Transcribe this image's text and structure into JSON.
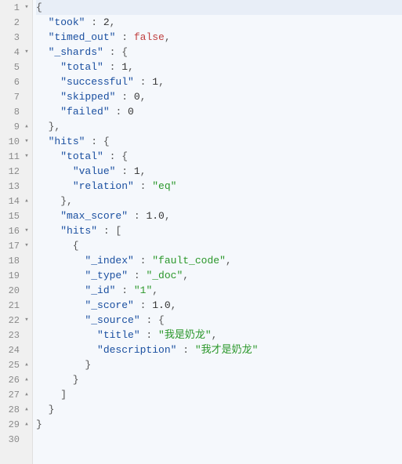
{
  "highlighted_line_index": 0,
  "code_lines": [
    {
      "num": "1",
      "fold": "▾",
      "tokens": [
        [
          "pn",
          "{"
        ]
      ]
    },
    {
      "num": "2",
      "fold": "",
      "tokens": [
        [
          "pn",
          "  "
        ],
        [
          "nm",
          "\"took\""
        ],
        [
          "pn",
          " : "
        ],
        [
          "num",
          "2"
        ],
        [
          "pn",
          ","
        ]
      ]
    },
    {
      "num": "3",
      "fold": "",
      "tokens": [
        [
          "pn",
          "  "
        ],
        [
          "nm",
          "\"timed_out\""
        ],
        [
          "pn",
          " : "
        ],
        [
          "kw",
          "false"
        ],
        [
          "pn",
          ","
        ]
      ]
    },
    {
      "num": "4",
      "fold": "▾",
      "tokens": [
        [
          "pn",
          "  "
        ],
        [
          "nm",
          "\"_shards\""
        ],
        [
          "pn",
          " : {"
        ]
      ]
    },
    {
      "num": "5",
      "fold": "",
      "tokens": [
        [
          "pn",
          "    "
        ],
        [
          "nm",
          "\"total\""
        ],
        [
          "pn",
          " : "
        ],
        [
          "num",
          "1"
        ],
        [
          "pn",
          ","
        ]
      ]
    },
    {
      "num": "6",
      "fold": "",
      "tokens": [
        [
          "pn",
          "    "
        ],
        [
          "nm",
          "\"successful\""
        ],
        [
          "pn",
          " : "
        ],
        [
          "num",
          "1"
        ],
        [
          "pn",
          ","
        ]
      ]
    },
    {
      "num": "7",
      "fold": "",
      "tokens": [
        [
          "pn",
          "    "
        ],
        [
          "nm",
          "\"skipped\""
        ],
        [
          "pn",
          " : "
        ],
        [
          "num",
          "0"
        ],
        [
          "pn",
          ","
        ]
      ]
    },
    {
      "num": "8",
      "fold": "",
      "tokens": [
        [
          "pn",
          "    "
        ],
        [
          "nm",
          "\"failed\""
        ],
        [
          "pn",
          " : "
        ],
        [
          "num",
          "0"
        ]
      ]
    },
    {
      "num": "9",
      "fold": "▴",
      "tokens": [
        [
          "pn",
          "  },"
        ]
      ]
    },
    {
      "num": "10",
      "fold": "▾",
      "tokens": [
        [
          "pn",
          "  "
        ],
        [
          "nm",
          "\"hits\""
        ],
        [
          "pn",
          " : {"
        ]
      ]
    },
    {
      "num": "11",
      "fold": "▾",
      "tokens": [
        [
          "pn",
          "    "
        ],
        [
          "nm",
          "\"total\""
        ],
        [
          "pn",
          " : {"
        ]
      ]
    },
    {
      "num": "12",
      "fold": "",
      "tokens": [
        [
          "pn",
          "      "
        ],
        [
          "nm",
          "\"value\""
        ],
        [
          "pn",
          " : "
        ],
        [
          "num",
          "1"
        ],
        [
          "pn",
          ","
        ]
      ]
    },
    {
      "num": "13",
      "fold": "",
      "tokens": [
        [
          "pn",
          "      "
        ],
        [
          "nm",
          "\"relation\""
        ],
        [
          "pn",
          " : "
        ],
        [
          "str",
          "\"eq\""
        ]
      ]
    },
    {
      "num": "14",
      "fold": "▴",
      "tokens": [
        [
          "pn",
          "    },"
        ]
      ]
    },
    {
      "num": "15",
      "fold": "",
      "tokens": [
        [
          "pn",
          "    "
        ],
        [
          "nm",
          "\"max_score\""
        ],
        [
          "pn",
          " : "
        ],
        [
          "num",
          "1.0"
        ],
        [
          "pn",
          ","
        ]
      ]
    },
    {
      "num": "16",
      "fold": "▾",
      "tokens": [
        [
          "pn",
          "    "
        ],
        [
          "nm",
          "\"hits\""
        ],
        [
          "pn",
          " : ["
        ]
      ]
    },
    {
      "num": "17",
      "fold": "▾",
      "tokens": [
        [
          "pn",
          "      {"
        ]
      ]
    },
    {
      "num": "18",
      "fold": "",
      "tokens": [
        [
          "pn",
          "        "
        ],
        [
          "nm",
          "\"_index\""
        ],
        [
          "pn",
          " : "
        ],
        [
          "str",
          "\"fault_code\""
        ],
        [
          "pn",
          ","
        ]
      ]
    },
    {
      "num": "19",
      "fold": "",
      "tokens": [
        [
          "pn",
          "        "
        ],
        [
          "nm",
          "\"_type\""
        ],
        [
          "pn",
          " : "
        ],
        [
          "str",
          "\"_doc\""
        ],
        [
          "pn",
          ","
        ]
      ]
    },
    {
      "num": "20",
      "fold": "",
      "tokens": [
        [
          "pn",
          "        "
        ],
        [
          "nm",
          "\"_id\""
        ],
        [
          "pn",
          " : "
        ],
        [
          "str",
          "\"1\""
        ],
        [
          "pn",
          ","
        ]
      ]
    },
    {
      "num": "21",
      "fold": "",
      "tokens": [
        [
          "pn",
          "        "
        ],
        [
          "nm",
          "\"_score\""
        ],
        [
          "pn",
          " : "
        ],
        [
          "num",
          "1.0"
        ],
        [
          "pn",
          ","
        ]
      ]
    },
    {
      "num": "22",
      "fold": "▾",
      "tokens": [
        [
          "pn",
          "        "
        ],
        [
          "nm",
          "\"_source\""
        ],
        [
          "pn",
          " : {"
        ]
      ]
    },
    {
      "num": "23",
      "fold": "",
      "tokens": [
        [
          "pn",
          "          "
        ],
        [
          "nm",
          "\"title\""
        ],
        [
          "pn",
          " : "
        ],
        [
          "str",
          "\"我是奶龙\""
        ],
        [
          "pn",
          ","
        ]
      ]
    },
    {
      "num": "24",
      "fold": "",
      "tokens": [
        [
          "pn",
          "          "
        ],
        [
          "nm",
          "\"description\""
        ],
        [
          "pn",
          " : "
        ],
        [
          "str",
          "\"我才是奶龙\""
        ]
      ]
    },
    {
      "num": "25",
      "fold": "▴",
      "tokens": [
        [
          "pn",
          "        }"
        ]
      ]
    },
    {
      "num": "26",
      "fold": "▴",
      "tokens": [
        [
          "pn",
          "      }"
        ]
      ]
    },
    {
      "num": "27",
      "fold": "▴",
      "tokens": [
        [
          "pn",
          "    ]"
        ]
      ]
    },
    {
      "num": "28",
      "fold": "▴",
      "tokens": [
        [
          "pn",
          "  }"
        ]
      ]
    },
    {
      "num": "29",
      "fold": "▴",
      "tokens": [
        [
          "pn",
          "}"
        ]
      ]
    },
    {
      "num": "30",
      "fold": "",
      "tokens": []
    }
  ]
}
